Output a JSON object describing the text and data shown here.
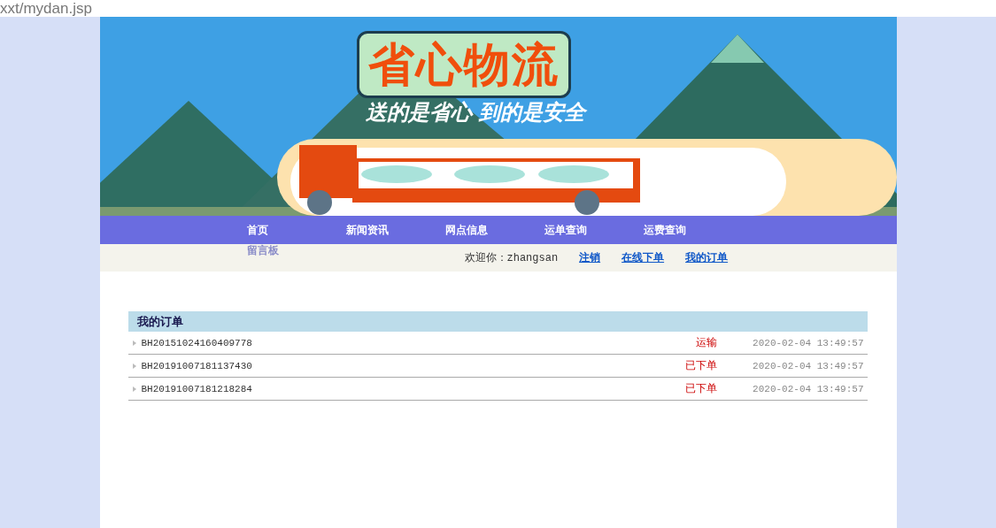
{
  "address_bar": {
    "url": "xxt/mydan.jsp"
  },
  "banner": {
    "kind": "picture",
    "title": "省心物流",
    "slogan": "送的是省心 到的是安全"
  },
  "nav": [
    {
      "label": "首页"
    },
    {
      "label": "新闻资讯"
    },
    {
      "label": "网点信息"
    },
    {
      "label": "运单查询"
    },
    {
      "label": "运费查询"
    },
    {
      "label": "留言板"
    }
  ],
  "user_bar": {
    "welcome": "欢迎你：zhangsan",
    "links": [
      "注销",
      "在线下单",
      "我的订单"
    ]
  },
  "orders": {
    "title": "我的订单",
    "rows": [
      {
        "number": "BH20151024160409778",
        "status": "运输",
        "time": "2020-02-04 13:49:57"
      },
      {
        "number": "BH20191007181137430",
        "status": "已下单",
        "time": "2020-02-04 13:49:57"
      },
      {
        "number": "BH20191007181218284",
        "status": "已下单",
        "time": "2020-02-04 13:49:57"
      }
    ]
  }
}
